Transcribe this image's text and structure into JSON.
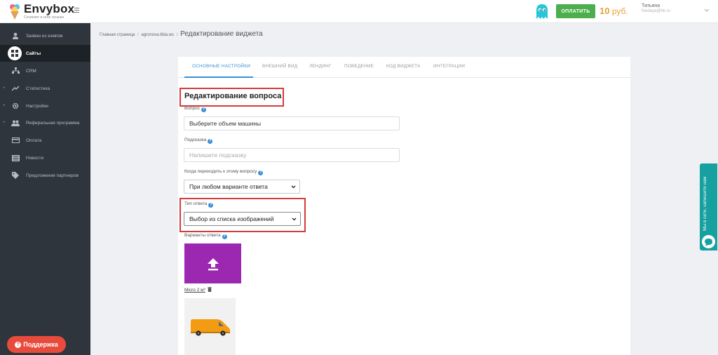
{
  "header": {
    "logo_name": "Envybox",
    "logo_tagline": "Сочиняет в себе лучшее",
    "pay_button": "ОПЛАТИТЬ",
    "balance_amount": "10",
    "balance_currency": "руб.",
    "user_name": "Татьяна",
    "user_email": "fnedaya@bk.ru"
  },
  "sidebar": {
    "items": [
      {
        "label": "Заявки из кэмпов",
        "icon": "user-icon",
        "expandable": false
      },
      {
        "label": "Сайты",
        "icon": "grid-icon",
        "expandable": false,
        "active": true
      },
      {
        "label": "CRM",
        "icon": "sitemap-icon",
        "expandable": false
      },
      {
        "label": "Статистика",
        "icon": "trend-icon",
        "expandable": true
      },
      {
        "label": "Настройки",
        "icon": "gear-icon",
        "expandable": true
      },
      {
        "label": "Реферальная программа",
        "icon": "users-icon",
        "expandable": true
      },
      {
        "label": "Оплата",
        "icon": "credit-card-icon",
        "expandable": false
      },
      {
        "label": "Новости",
        "icon": "newspaper-icon",
        "expandable": false
      },
      {
        "label": "Предложения партнеров",
        "icon": "tag-icon",
        "expandable": false
      }
    ],
    "support_button": "Поддержка"
  },
  "breadcrumb": {
    "home": "Главная страница",
    "site": "agronova.tilda.ws",
    "current": "Редактирование виджета"
  },
  "tabs": [
    {
      "label": "ОСНОВНЫЕ НАСТРОЙКИ",
      "active": true
    },
    {
      "label": "ВНЕШНИЙ ВИД"
    },
    {
      "label": "ЛЕНДИНГ"
    },
    {
      "label": "ПОВЕДЕНИЕ"
    },
    {
      "label": "КОД ВИДЖЕТА"
    },
    {
      "label": "ИНТЕГРАЦИИ"
    }
  ],
  "form": {
    "section_title": "Редактирование вопроса",
    "question_label": "Вопрос",
    "question_value": "Выберите объем машины",
    "hint_label": "Подсказка",
    "hint_placeholder": "Напишите подсказку",
    "when_label": "Когда переходить к этому вопросу",
    "when_value": "При любом варианте ответа",
    "answer_type_label": "Тип ответа",
    "answer_type_value": "Выбор из списка изображений",
    "options_label": "Варианты ответа",
    "option_caption": "Micro 2 м³"
  },
  "chat_widget": {
    "text": "Мы в сети, напишите нам"
  },
  "colors": {
    "accent": "#3a8fd6",
    "pay_green": "#4cae4c",
    "balance_orange": "#e8a33c",
    "sidebar_bg": "#2f353c",
    "highlight_red": "#d43b3b",
    "upload_purple": "#9c27b0",
    "support_red": "#e84b3c",
    "chat_teal": "#17a0a0"
  }
}
